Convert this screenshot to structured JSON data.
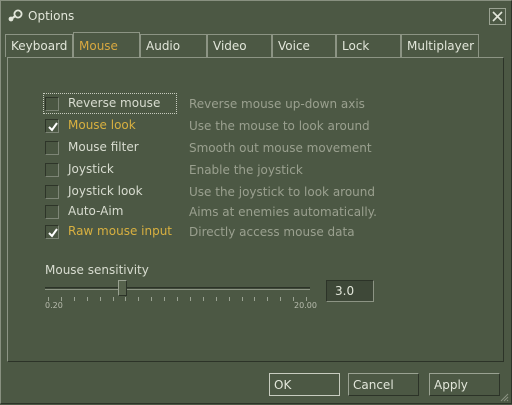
{
  "window": {
    "title": "Options",
    "icon": "steam-logo-icon",
    "close_icon": "close-icon"
  },
  "tabs": [
    {
      "label": "Keyboard",
      "active": false
    },
    {
      "label": "Mouse",
      "active": true
    },
    {
      "label": "Audio",
      "active": false
    },
    {
      "label": "Video",
      "active": false
    },
    {
      "label": "Voice",
      "active": false
    },
    {
      "label": "Lock",
      "active": false
    },
    {
      "label": "Multiplayer",
      "active": false
    }
  ],
  "options": [
    {
      "label": "Reverse mouse",
      "description": "Reverse mouse up-down axis",
      "checked": false
    },
    {
      "label": "Mouse look",
      "description": "Use the mouse to look around",
      "checked": true
    },
    {
      "label": "Mouse filter",
      "description": "Smooth out mouse movement",
      "checked": false
    },
    {
      "label": "Joystick",
      "description": "Enable the joystick",
      "checked": false
    },
    {
      "label": "Joystick look",
      "description": "Use the joystick to look around",
      "checked": false
    },
    {
      "label": "Auto-Aim",
      "description": "Aims at enemies automatically.",
      "checked": false
    },
    {
      "label": "Raw mouse input",
      "description": "Directly access mouse data",
      "checked": true
    }
  ],
  "sensitivity": {
    "label": "Mouse sensitivity",
    "min_label": "0.20",
    "max_label": "20.00",
    "min": 0.2,
    "max": 20.0,
    "value": 3.0,
    "value_text": "3.0"
  },
  "buttons": {
    "ok": "OK",
    "cancel": "Cancel",
    "apply": "Apply"
  },
  "colors": {
    "background": "#4c5844",
    "accent": "#d8a840",
    "text": "#d8dcd0",
    "description": "#9aa08f"
  }
}
